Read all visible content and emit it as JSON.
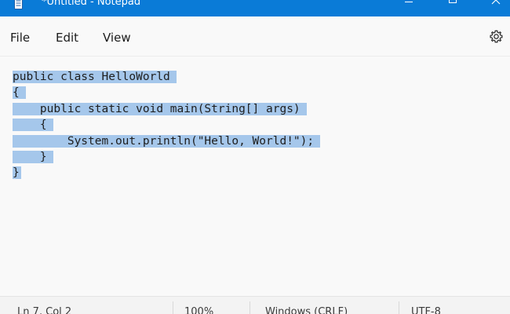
{
  "titlebar": {
    "title": "*Untitled - Notepad",
    "background": "#0a7bd7",
    "app_icon": "notepad-icon",
    "controls": [
      "minimize-icon",
      "maximize-icon",
      "close-icon"
    ]
  },
  "menu": {
    "items": [
      {
        "label": "File"
      },
      {
        "label": "Edit"
      },
      {
        "label": "View"
      }
    ],
    "settings_icon": "gear-icon"
  },
  "editor": {
    "selection_color": "#a5c7eb",
    "lines": [
      "public class HelloWorld",
      "{",
      "    public static void main(String[] args)",
      "    {",
      "        System.out.println(\"Hello, World!\");",
      "    }",
      "}"
    ]
  },
  "status": {
    "position": "Ln 7, Col 2",
    "zoom": "100%",
    "line_ending": "Windows (CRLF)",
    "encoding": "UTF-8"
  }
}
